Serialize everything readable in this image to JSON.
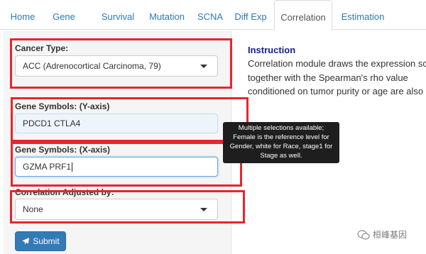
{
  "tabs": [
    {
      "label": "Home"
    },
    {
      "label": "Gene"
    },
    {
      "label": "Survival"
    },
    {
      "label": "Mutation"
    },
    {
      "label": "SCNA"
    },
    {
      "label": "Diff Exp"
    },
    {
      "label": "Correlation",
      "active": true
    },
    {
      "label": "Estimation"
    }
  ],
  "form": {
    "cancer_type": {
      "label": "Cancer Type:",
      "value": "ACC (Adrenocortical Carcinoma, 79)"
    },
    "gene_y": {
      "label": "Gene Symbols: (Y-axis)",
      "value": "PDCD1 CTLA4"
    },
    "gene_x": {
      "label": "Gene Symbols: (X-axis)",
      "value": "GZMA PRF1"
    },
    "adjusted_by": {
      "label": "Correlation Adjusted by:",
      "value": "None"
    },
    "submit_label": "Submit"
  },
  "instruction": {
    "title": "Instruction",
    "lines": [
      "Correlation module draws the expression sc",
      "together with the Spearman's rho value",
      "conditioned on tumor purity or age are also"
    ]
  },
  "tooltip": {
    "lines": [
      "Multiple selections available;",
      "Female is the reference level for",
      "Gender, white for Race, stage1 for",
      "Stage as well."
    ]
  },
  "watermark": {
    "text": "桓峰基因"
  },
  "colors": {
    "highlight": "#e6262e",
    "link": "#2a7ab8",
    "submit": "#337ab7"
  }
}
